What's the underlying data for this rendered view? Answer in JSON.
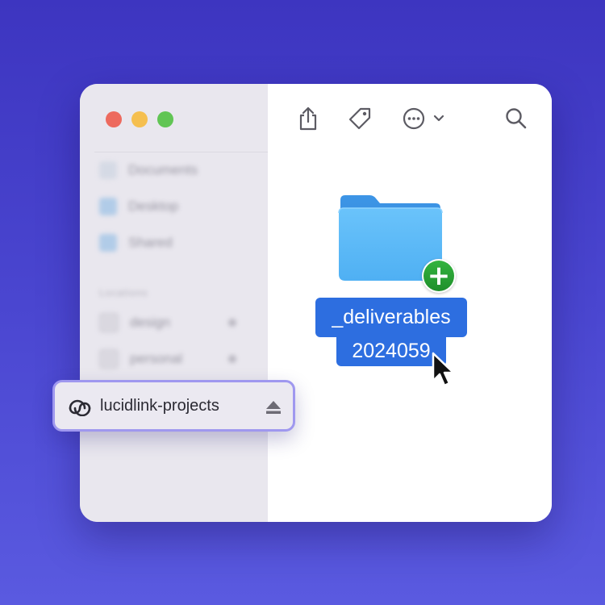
{
  "window": {
    "traffic_lights": {
      "close_color": "#ed6a5e",
      "minimize_color": "#f5bf4f",
      "zoom_color": "#61c554"
    }
  },
  "sidebar": {
    "favorites": [
      {
        "label": "Documents",
        "icon": "document-icon"
      },
      {
        "label": "Desktop",
        "icon": "desktop-icon"
      },
      {
        "label": "Shared",
        "icon": "shared-folder-icon"
      }
    ],
    "section_locations": "Locations",
    "locations": [
      {
        "label": "design",
        "icon": "drive-icon"
      },
      {
        "label": "personal",
        "icon": "drive-icon"
      }
    ],
    "highlighted_location": {
      "label": "lucidlink-projects",
      "icon": "lucidlink-logo-icon",
      "action_icon": "eject-icon"
    }
  },
  "toolbar": {
    "icons": [
      "share-icon",
      "tag-icon",
      "more-options-icon",
      "chevron-down-icon",
      "search-icon"
    ]
  },
  "content": {
    "folder": {
      "name_line1": "_deliverables",
      "name_line2": "2024059",
      "badge": "+",
      "folder_color": "#5ab3f5",
      "selection_color": "#2d6ee0",
      "badge_color": "#2aa036"
    }
  },
  "colors": {
    "background": "#4a46d0",
    "pill_border": "#9f98ef"
  }
}
